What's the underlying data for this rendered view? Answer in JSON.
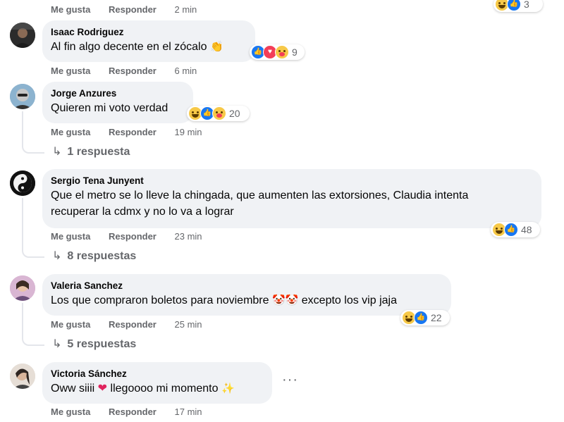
{
  "labels": {
    "like": "Me gusta",
    "reply": "Responder"
  },
  "top": {
    "time": "2 min",
    "reaction_count": "3"
  },
  "comments": [
    {
      "author": "Isaac Rodriguez",
      "text": "Al fin algo decente en el zócalo",
      "emoji": "clapping-hands",
      "time": "6 min",
      "reaction_count": "9",
      "reactions": [
        "like",
        "love",
        "care"
      ]
    },
    {
      "author": "Jorge Anzures",
      "text": "Quieren mi voto verdad",
      "time": "19 min",
      "reaction_count": "20",
      "reactions": [
        "haha",
        "like",
        "care"
      ],
      "replies": "1 respuesta"
    },
    {
      "author": "Sergio Tena Junyent",
      "text_line1": "Que el metro se lo lleve la chingada, que aumenten las extorsiones, Claudia intenta",
      "text_line2": "recuperar la cdmx y no lo va a lograr",
      "time": "23 min",
      "reaction_count": "48",
      "reactions": [
        "haha",
        "like"
      ],
      "replies": "8 respuestas"
    },
    {
      "author": "Valeria Sanchez",
      "text_a": "Los que compraron boletos para noviembre",
      "text_b": "excepto los vip jaja",
      "emoji": "clown-face",
      "time": "25 min",
      "reaction_count": "22",
      "reactions": [
        "haha",
        "like"
      ],
      "replies": "5 respuestas"
    },
    {
      "author": "Victoria Sánchez",
      "text_a": "Oww siiii",
      "text_b": "llegoooo mi momento",
      "emoji_a": "red-heart",
      "emoji_b": "sparkles",
      "time": "17 min",
      "more": "···"
    }
  ],
  "colors": {
    "bubble": "#f0f2f5",
    "meta": "#65676b",
    "like_blue": "#1877f2",
    "love_red": "#f33e58",
    "haha_yellow": "#f7c948"
  }
}
